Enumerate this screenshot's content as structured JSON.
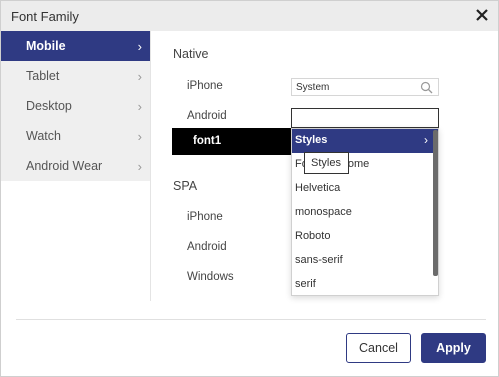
{
  "dialog": {
    "title": "Font Family"
  },
  "sidebar": {
    "items": [
      {
        "label": "Mobile",
        "active": true
      },
      {
        "label": "Tablet"
      },
      {
        "label": "Desktop"
      },
      {
        "label": "Watch"
      },
      {
        "label": "Android Wear"
      }
    ]
  },
  "native": {
    "heading": "Native",
    "rows": [
      {
        "label": "iPhone",
        "value": "System"
      },
      {
        "label": "Android",
        "value": ""
      }
    ],
    "selected_row": "font1"
  },
  "spa": {
    "heading": "SPA",
    "rows": [
      {
        "label": "iPhone"
      },
      {
        "label": "Android"
      },
      {
        "label": "Windows"
      }
    ]
  },
  "dropdown": {
    "items": [
      "Styles",
      "FontAwesome",
      "Helvetica",
      "monospace",
      "Roboto",
      "sans-serif",
      "serif"
    ],
    "item_0_truncated": "Fo",
    "item_1_tail": "ome"
  },
  "tooltip": {
    "text": "Styles"
  },
  "buttons": {
    "cancel": "Cancel",
    "apply": "Apply"
  },
  "colors": {
    "accent": "#2f3a83"
  },
  "icons": {
    "close": "close-icon",
    "search": "search-icon",
    "chevron": "chevron-right-icon"
  }
}
